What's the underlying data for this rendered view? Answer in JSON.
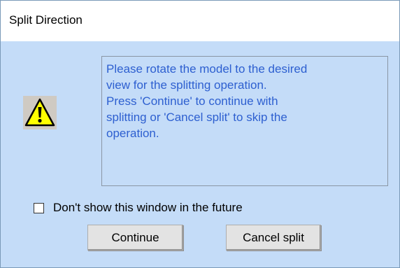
{
  "window": {
    "title": "Split Direction"
  },
  "icon": {
    "name": "warning-icon",
    "color": "#ffff00"
  },
  "message": {
    "lines": [
      "Please rotate the model to the desired",
      "view for the splitting operation.",
      "Press 'Continue' to continue with",
      "splitting or 'Cancel split' to skip the",
      "operation."
    ]
  },
  "checkbox": {
    "label": "Don't show this window in the future",
    "checked": false
  },
  "buttons": {
    "continue": "Continue",
    "cancel": "Cancel split"
  },
  "colors": {
    "background": "#c4dcf8",
    "message_text": "#2d5fd0"
  }
}
